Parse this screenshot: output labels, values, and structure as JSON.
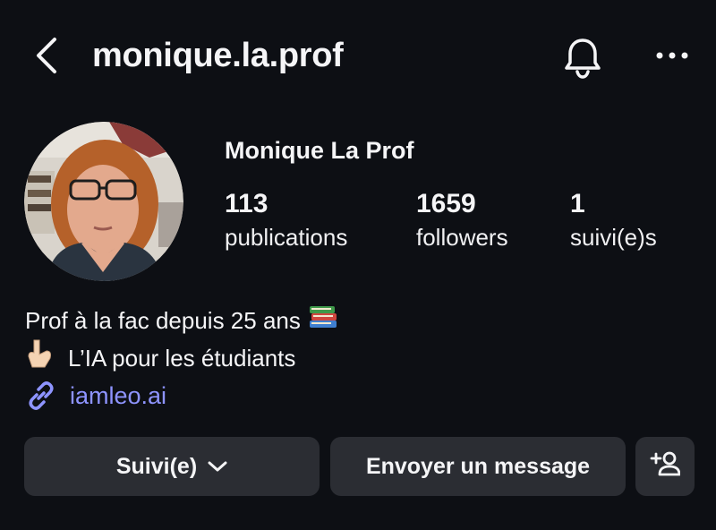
{
  "header": {
    "username": "monique.la.prof",
    "back_icon": "chevron-left-icon",
    "bell_icon": "bell-icon",
    "more_icon": "ellipsis-icon"
  },
  "profile": {
    "full_name": "Monique La Prof",
    "stats": [
      {
        "value": "113",
        "label": "publications"
      },
      {
        "value": "1659",
        "label": "followers"
      },
      {
        "value": "1",
        "label": "suivi(e)s"
      }
    ],
    "bio_lines": [
      {
        "text": "Prof à la fac depuis 25 ans",
        "emoji": "books-emoji"
      },
      {
        "text": "L’IA pour les étudiants",
        "emoji": "pointing-down-emoji"
      }
    ],
    "link": {
      "text": "iamleo.ai",
      "icon": "link-icon"
    }
  },
  "actions": {
    "follow_label": "Suivi(e)",
    "message_label": "Envoyer un message",
    "add_user_icon": "add-person-icon"
  },
  "colors": {
    "background": "#0d0f14",
    "button": "#2b2d33",
    "link": "#8e94ff"
  }
}
